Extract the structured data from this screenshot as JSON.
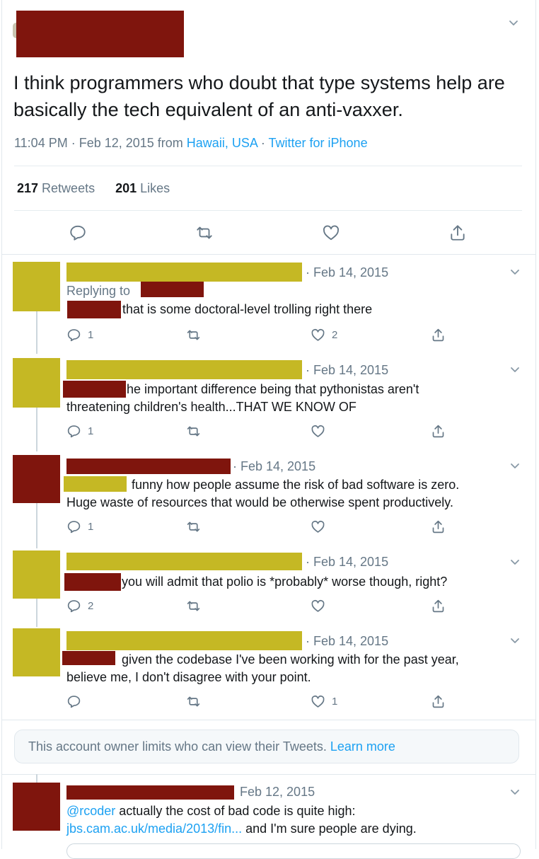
{
  "tweet": {
    "text": "I think programmers who doubt that type systems help are basically the tech equivalent of an anti-vaxxer.",
    "time": "11:04 PM · Feb 12, 2015 from ",
    "location": "Hawaii, USA",
    "separator": " · ",
    "source": "Twitter for iPhone",
    "retweets_count": "217",
    "retweets_label": " Retweets",
    "likes_count": "201",
    "likes_label": " Likes"
  },
  "replies": [
    {
      "date": "· Feb 14, 2015",
      "replying_to": "Replying to",
      "text": "that is some doctoral-level trolling right there",
      "reply_count": "1",
      "retweet_count": "",
      "like_count": "2"
    },
    {
      "date": "· Feb 14, 2015",
      "text_line1": "he important difference being that pythonistas aren't",
      "text_line2": "threatening children's health...THAT WE KNOW OF",
      "reply_count": "1",
      "like_count": ""
    },
    {
      "date": "· Feb 14, 2015",
      "text_line1": "funny how people assume the risk of bad software is zero.",
      "text_line2": "Huge waste of resources that would be otherwise spent productively.",
      "reply_count": "1",
      "like_count": ""
    },
    {
      "date": "· Feb 14, 2015",
      "text": "you will admit that polio is *probably* worse though, right?",
      "reply_count": "2",
      "like_count": ""
    },
    {
      "date": "· Feb 14, 2015",
      "text_line1": "given the codebase I've been working with for the past year,",
      "text_line2": "believe me, I don't disagree with your point.",
      "reply_count": "",
      "like_count": "1"
    },
    {
      "date": "Feb 12, 2015",
      "mention": "@rcoder",
      "text_line1": " actually the cost of bad code is quite high:",
      "link": "jbs.cam.ac.uk/media/2013/fin...",
      "text_line2_rest": " and I'm sure people are dying."
    }
  ],
  "notice": {
    "text": "This account owner limits who can view their Tweets.",
    "link": "Learn more"
  },
  "icons": [
    "chevron-down-icon",
    "reply-icon",
    "retweet-icon",
    "like-icon",
    "share-icon"
  ],
  "colors": {
    "link": "#1da1f2",
    "muted": "#657786",
    "redaction_red": "#7f150d",
    "redaction_yellow": "#c5b824"
  }
}
